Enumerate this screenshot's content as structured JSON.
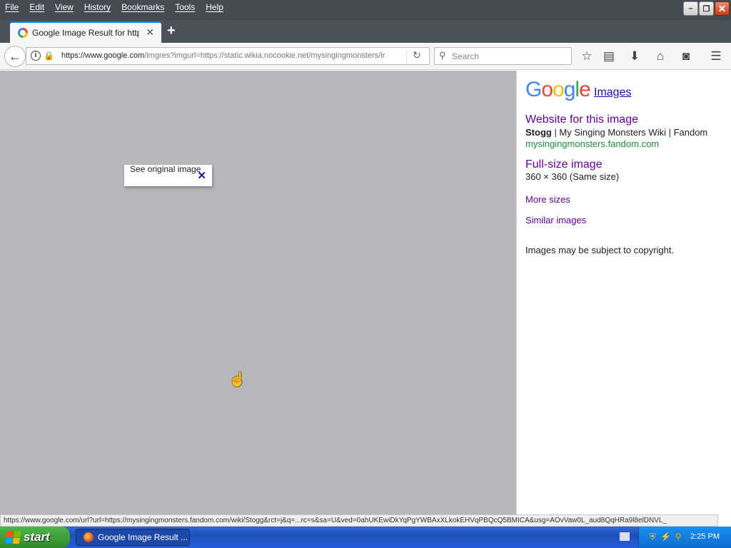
{
  "menu": [
    "File",
    "Edit",
    "View",
    "History",
    "Bookmarks",
    "Tools",
    "Help"
  ],
  "window_buttons": {
    "minimize": "–",
    "restore": "❐",
    "close": "✕"
  },
  "tab": {
    "title": "Google Image Result for http…",
    "close": "✕"
  },
  "new_tab": "+",
  "nav": {
    "url_host": "https://www.google.com",
    "url_rest": "/imgres?imgurl=https://static.wikia.nocookie.net/mysingingmonsters/ir",
    "search_placeholder": "Search"
  },
  "popup": {
    "text": "See original image",
    "close": "✕"
  },
  "sidebar": {
    "logo": [
      "G",
      "o",
      "o",
      "g",
      "l",
      "e"
    ],
    "images_link": "Images",
    "website_heading": "Website for this image",
    "site_title_bold": "Stogg",
    "site_title_rest": " | My Singing Monsters Wiki | Fandom",
    "site_url": "mysingingmonsters.fandom.com",
    "fullsize_heading": "Full-size image",
    "fullsize_dims": "360 × 360 (Same size)",
    "more_sizes": "More sizes",
    "similar_images": "Similar images",
    "copyright": "Images may be subject to copyright."
  },
  "status": "https://www.google.com/url?url=https://mysingingmonsters.fandom.com/wiki/Stogg&rct=j&q=...rc=s&sa=U&ved=0ahUKEwiDkYqPgYWBAxXLkokEHVqPBQcQ5BMICA&usg=AOvVaw0L_aud8QqHRa9l8elDNVL_",
  "taskbar": {
    "start": "start",
    "task_item": "Google Image Result ...",
    "clock": "2:25 PM"
  },
  "colors": {
    "viewer_bg": "#b6b8bc",
    "link_visited": "#660099",
    "link": "#1a0dab",
    "url_green": "#1e8e3e"
  }
}
